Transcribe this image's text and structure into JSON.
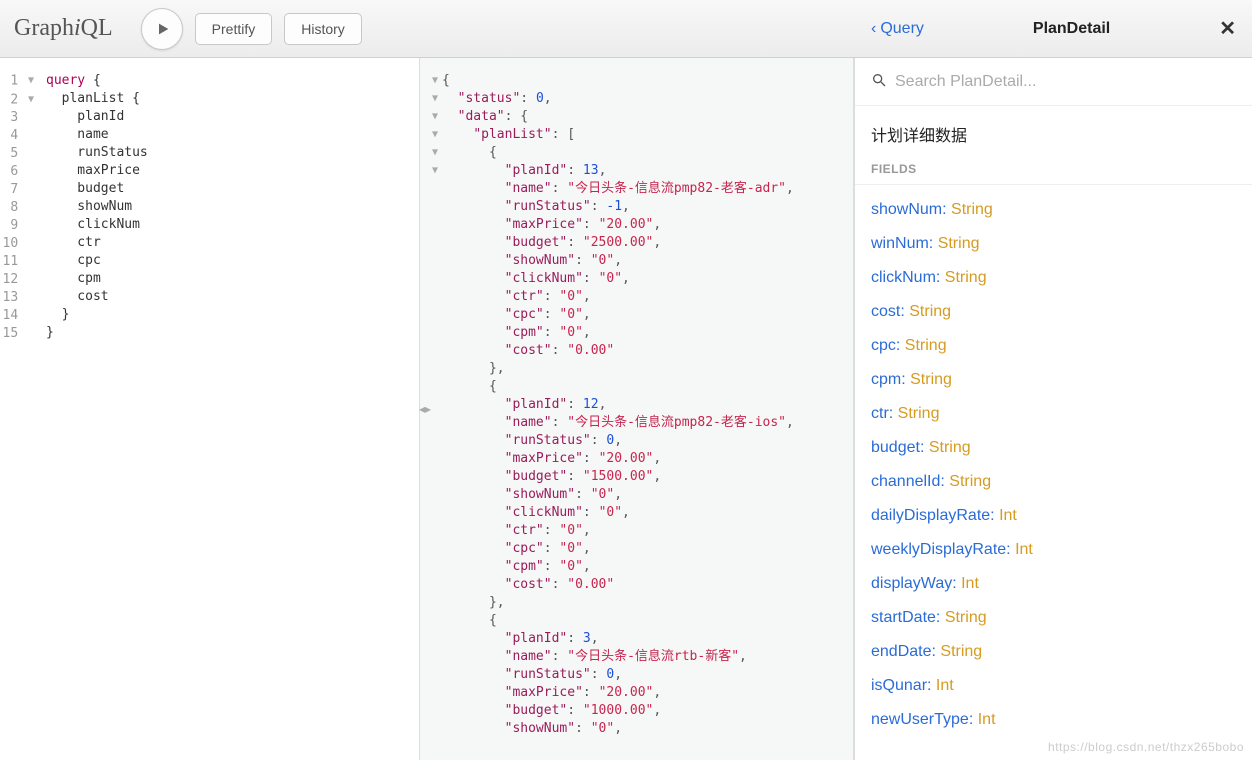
{
  "toolbar": {
    "logo_prefix": "Graph",
    "logo_italic": "i",
    "logo_suffix": "QL",
    "prettify": "Prettify",
    "history": "History"
  },
  "editor": {
    "lines": [
      "1",
      "2",
      "3",
      "4",
      "5",
      "6",
      "7",
      "8",
      "9",
      "10",
      "11",
      "12",
      "13",
      "14",
      "15"
    ],
    "query_lines": [
      {
        "indent": 0,
        "t": "query",
        "rest": " {",
        "kw": true,
        "fold": true
      },
      {
        "indent": 1,
        "t": "planList {",
        "fold": true
      },
      {
        "indent": 2,
        "t": "planId"
      },
      {
        "indent": 2,
        "t": "name"
      },
      {
        "indent": 2,
        "t": "runStatus"
      },
      {
        "indent": 2,
        "t": "maxPrice"
      },
      {
        "indent": 2,
        "t": "budget"
      },
      {
        "indent": 2,
        "t": "showNum"
      },
      {
        "indent": 2,
        "t": "clickNum"
      },
      {
        "indent": 2,
        "t": "ctr"
      },
      {
        "indent": 2,
        "t": "cpc"
      },
      {
        "indent": 2,
        "t": "cpm"
      },
      {
        "indent": 2,
        "t": "cost"
      },
      {
        "indent": 1,
        "t": "}"
      },
      {
        "indent": 0,
        "t": "}"
      }
    ]
  },
  "result": {
    "json_lines": [
      [
        {
          "p": "{"
        }
      ],
      [
        {
          "k": "\"status\""
        },
        {
          "p": ": "
        },
        {
          "n": "0"
        },
        {
          "p": ","
        }
      ],
      [
        {
          "k": "\"data\""
        },
        {
          "p": ": {"
        }
      ],
      [
        {
          "k": "\"planList\""
        },
        {
          "p": ": ["
        }
      ],
      [
        {
          "p": "{"
        }
      ],
      [
        {
          "k": "\"planId\""
        },
        {
          "p": ": "
        },
        {
          "n": "13"
        },
        {
          "p": ","
        }
      ],
      [
        {
          "k": "\"name\""
        },
        {
          "p": ": "
        },
        {
          "s": "\"今日头条-信息流pmp82-老客-adr\""
        },
        {
          "p": ","
        }
      ],
      [
        {
          "k": "\"runStatus\""
        },
        {
          "p": ": "
        },
        {
          "n": "-1"
        },
        {
          "p": ","
        }
      ],
      [
        {
          "k": "\"maxPrice\""
        },
        {
          "p": ": "
        },
        {
          "s": "\"20.00\""
        },
        {
          "p": ","
        }
      ],
      [
        {
          "k": "\"budget\""
        },
        {
          "p": ": "
        },
        {
          "s": "\"2500.00\""
        },
        {
          "p": ","
        }
      ],
      [
        {
          "k": "\"showNum\""
        },
        {
          "p": ": "
        },
        {
          "s": "\"0\""
        },
        {
          "p": ","
        }
      ],
      [
        {
          "k": "\"clickNum\""
        },
        {
          "p": ": "
        },
        {
          "s": "\"0\""
        },
        {
          "p": ","
        }
      ],
      [
        {
          "k": "\"ctr\""
        },
        {
          "p": ": "
        },
        {
          "s": "\"0\""
        },
        {
          "p": ","
        }
      ],
      [
        {
          "k": "\"cpc\""
        },
        {
          "p": ": "
        },
        {
          "s": "\"0\""
        },
        {
          "p": ","
        }
      ],
      [
        {
          "k": "\"cpm\""
        },
        {
          "p": ": "
        },
        {
          "s": "\"0\""
        },
        {
          "p": ","
        }
      ],
      [
        {
          "k": "\"cost\""
        },
        {
          "p": ": "
        },
        {
          "s": "\"0.00\""
        }
      ],
      [
        {
          "p": "},"
        }
      ],
      [
        {
          "p": "{"
        }
      ],
      [
        {
          "k": "\"planId\""
        },
        {
          "p": ": "
        },
        {
          "n": "12"
        },
        {
          "p": ","
        }
      ],
      [
        {
          "k": "\"name\""
        },
        {
          "p": ": "
        },
        {
          "s": "\"今日头条-信息流pmp82-老客-ios\""
        },
        {
          "p": ","
        }
      ],
      [
        {
          "k": "\"runStatus\""
        },
        {
          "p": ": "
        },
        {
          "n": "0"
        },
        {
          "p": ","
        }
      ],
      [
        {
          "k": "\"maxPrice\""
        },
        {
          "p": ": "
        },
        {
          "s": "\"20.00\""
        },
        {
          "p": ","
        }
      ],
      [
        {
          "k": "\"budget\""
        },
        {
          "p": ": "
        },
        {
          "s": "\"1500.00\""
        },
        {
          "p": ","
        }
      ],
      [
        {
          "k": "\"showNum\""
        },
        {
          "p": ": "
        },
        {
          "s": "\"0\""
        },
        {
          "p": ","
        }
      ],
      [
        {
          "k": "\"clickNum\""
        },
        {
          "p": ": "
        },
        {
          "s": "\"0\""
        },
        {
          "p": ","
        }
      ],
      [
        {
          "k": "\"ctr\""
        },
        {
          "p": ": "
        },
        {
          "s": "\"0\""
        },
        {
          "p": ","
        }
      ],
      [
        {
          "k": "\"cpc\""
        },
        {
          "p": ": "
        },
        {
          "s": "\"0\""
        },
        {
          "p": ","
        }
      ],
      [
        {
          "k": "\"cpm\""
        },
        {
          "p": ": "
        },
        {
          "s": "\"0\""
        },
        {
          "p": ","
        }
      ],
      [
        {
          "k": "\"cost\""
        },
        {
          "p": ": "
        },
        {
          "s": "\"0.00\""
        }
      ],
      [
        {
          "p": "},"
        }
      ],
      [
        {
          "p": "{"
        }
      ],
      [
        {
          "k": "\"planId\""
        },
        {
          "p": ": "
        },
        {
          "n": "3"
        },
        {
          "p": ","
        }
      ],
      [
        {
          "k": "\"name\""
        },
        {
          "p": ": "
        },
        {
          "s": "\"今日头条-信息流rtb-新客\""
        },
        {
          "p": ","
        }
      ],
      [
        {
          "k": "\"runStatus\""
        },
        {
          "p": ": "
        },
        {
          "n": "0"
        },
        {
          "p": ","
        }
      ],
      [
        {
          "k": "\"maxPrice\""
        },
        {
          "p": ": "
        },
        {
          "s": "\"20.00\""
        },
        {
          "p": ","
        }
      ],
      [
        {
          "k": "\"budget\""
        },
        {
          "p": ": "
        },
        {
          "s": "\"1000.00\""
        },
        {
          "p": ","
        }
      ],
      [
        {
          "k": "\"showNum\""
        },
        {
          "p": ": "
        },
        {
          "s": "\"0\""
        },
        {
          "p": ","
        }
      ]
    ],
    "indents": [
      0,
      1,
      1,
      2,
      3,
      4,
      4,
      4,
      4,
      4,
      4,
      4,
      4,
      4,
      4,
      4,
      3,
      3,
      4,
      4,
      4,
      4,
      4,
      4,
      4,
      4,
      4,
      4,
      4,
      3,
      3,
      4,
      4,
      4,
      4,
      4,
      4
    ],
    "fold_rows": [
      0,
      2,
      3,
      4,
      17,
      30
    ]
  },
  "docs": {
    "back_label": "Query",
    "title": "PlanDetail",
    "search_placeholder": "Search PlanDetail...",
    "description": "计划详细数据",
    "section": "FIELDS",
    "fields": [
      {
        "name": "showNum",
        "type": "String"
      },
      {
        "name": "winNum",
        "type": "String"
      },
      {
        "name": "clickNum",
        "type": "String"
      },
      {
        "name": "cost",
        "type": "String"
      },
      {
        "name": "cpc",
        "type": "String"
      },
      {
        "name": "cpm",
        "type": "String"
      },
      {
        "name": "ctr",
        "type": "String"
      },
      {
        "name": "budget",
        "type": "String"
      },
      {
        "name": "channelId",
        "type": "String"
      },
      {
        "name": "dailyDisplayRate",
        "type": "Int"
      },
      {
        "name": "weeklyDisplayRate",
        "type": "Int"
      },
      {
        "name": "displayWay",
        "type": "Int"
      },
      {
        "name": "startDate",
        "type": "String"
      },
      {
        "name": "endDate",
        "type": "String"
      },
      {
        "name": "isQunar",
        "type": "Int"
      },
      {
        "name": "newUserType",
        "type": "Int"
      }
    ]
  },
  "watermark": "https://blog.csdn.net/thzx265bobo"
}
